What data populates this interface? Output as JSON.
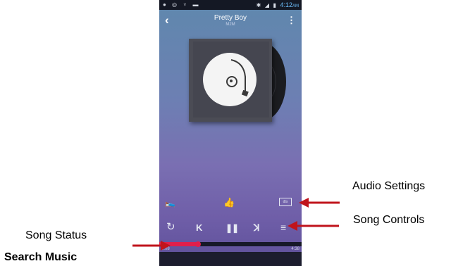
{
  "status_bar": {
    "left_icons": [
      "notification-icon",
      "settings-icon",
      "usb-icon",
      "gallery-icon"
    ],
    "right_icons": [
      "bluetooth-icon",
      "signal-icon",
      "battery-icon"
    ],
    "time": "4:12",
    "ampm": "AM"
  },
  "header": {
    "title": "Pretty Boy",
    "subtitle": "M2M",
    "back_icon": "back-chevron-icon",
    "menu_icon": "more-vertical-icon"
  },
  "album_art": {
    "icon": "turntable-icon"
  },
  "controls_row1": {
    "sleep_icon": "sleep-timer-icon",
    "like_icon": "thumbs-up-icon",
    "dts_label": "dts"
  },
  "controls_row2": [
    "repeat-icon",
    "previous-icon",
    "pause-icon",
    "next-icon",
    "queue-icon"
  ],
  "progress": {
    "elapsed": "0:08",
    "duration": "4:38",
    "fraction": 0.27
  },
  "callouts": {
    "audio_settings": "Audio Settings",
    "song_controls": "Song Controls",
    "song_status": "Song Status",
    "search_music": "Search Music"
  },
  "colors": {
    "accent": "#e11f4b",
    "arrow": "#c0141c",
    "status_bar": "#141824"
  }
}
